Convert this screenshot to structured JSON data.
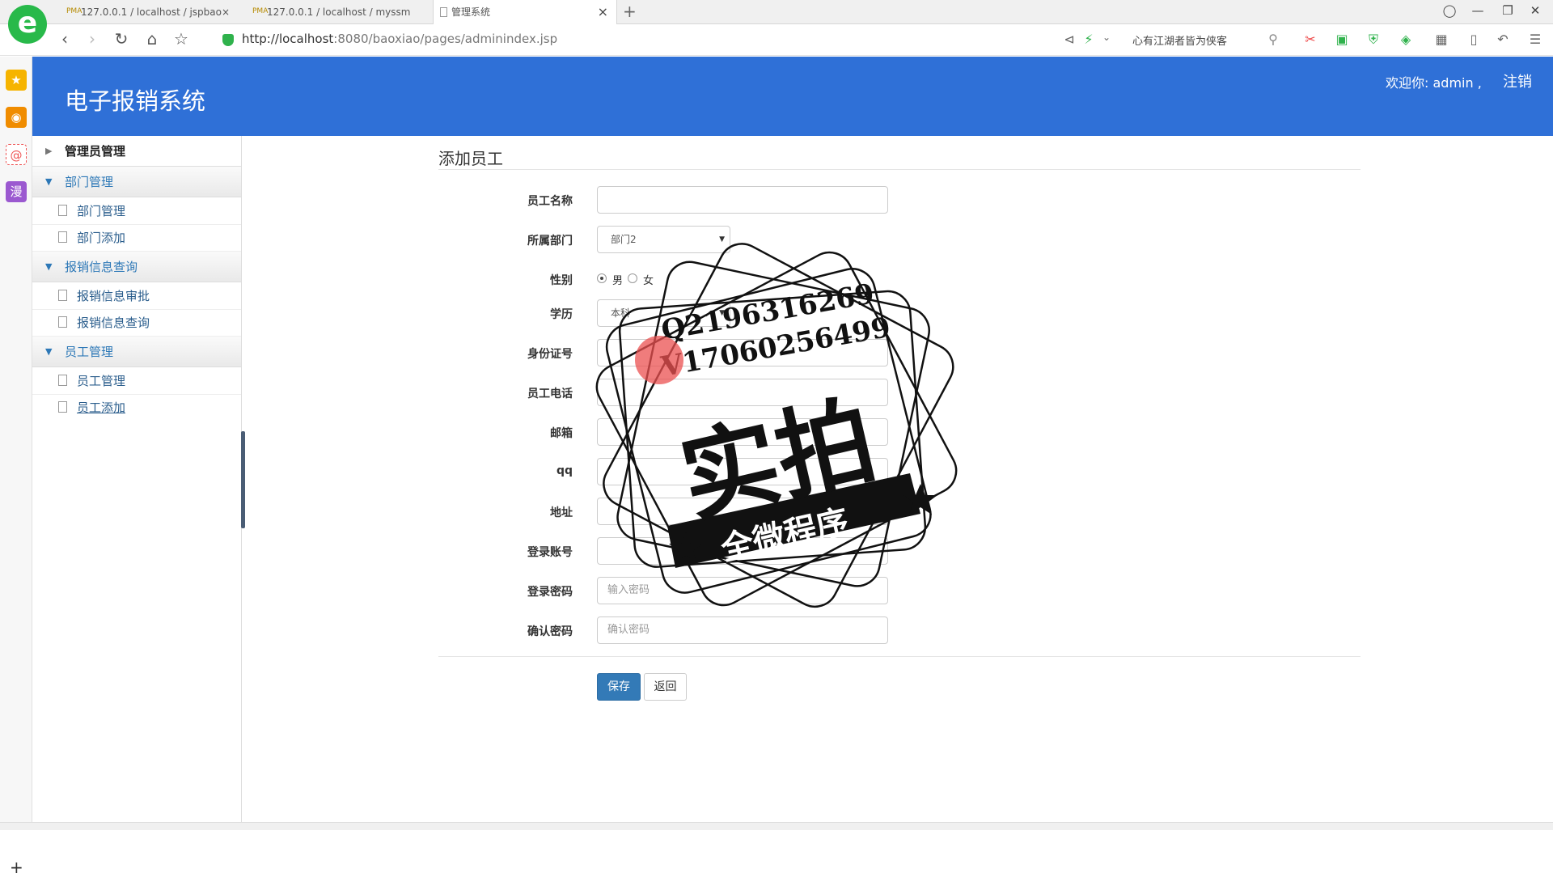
{
  "browser": {
    "tabs": [
      {
        "title": "127.0.0.1 / localhost / jspbao×",
        "icon_label": "PMA"
      },
      {
        "title": "127.0.0.1 / localhost / myssm",
        "icon_label": "PMA"
      },
      {
        "title": "管理系统",
        "close": "×"
      }
    ],
    "new_tab": "+",
    "url_host": "http://localhost",
    "url_rest": ":8080/baoxiao/pages/adminindex.jsp",
    "search_text": "心有江湖者皆为侠客"
  },
  "left_bar": {
    "icons": [
      "star-icon",
      "weibo-icon",
      "mail-icon",
      "comic-icon"
    ],
    "mail_glyph": "@",
    "comic_glyph": "漫",
    "add": "+"
  },
  "header": {
    "title": "电子报销系统",
    "welcome": "欢迎你: admin ,",
    "logout": "注销"
  },
  "sidebar": {
    "sections": [
      {
        "label": "管理员管理",
        "expanded": false,
        "items": []
      },
      {
        "label": "部门管理",
        "expanded": true,
        "items": [
          "部门管理",
          "部门添加"
        ]
      },
      {
        "label": "报销信息查询",
        "expanded": true,
        "items": [
          "报销信息审批",
          "报销信息查询"
        ]
      },
      {
        "label": "员工管理",
        "expanded": true,
        "items": [
          "员工管理",
          "员工添加"
        ]
      }
    ]
  },
  "form": {
    "title": "添加员工",
    "fields": {
      "name": {
        "label": "员工名称",
        "value": ""
      },
      "department": {
        "label": "所属部门",
        "value": "部门2"
      },
      "gender": {
        "label": "性别",
        "options": [
          "男",
          "女"
        ],
        "selected": "男"
      },
      "education": {
        "label": "学历",
        "value": "本科"
      },
      "id_number": {
        "label": "身份证号",
        "value": ""
      },
      "phone": {
        "label": "员工电话",
        "value": ""
      },
      "email": {
        "label": "邮箱",
        "value": ""
      },
      "qq": {
        "label": "qq",
        "value": ""
      },
      "address": {
        "label": "地址",
        "value": ""
      },
      "login_account": {
        "label": "登录账号",
        "value": ""
      },
      "login_password": {
        "label": "登录密码",
        "placeholder": "输入密码"
      },
      "confirm_password": {
        "label": "确认密码",
        "placeholder": "确认密码"
      }
    },
    "save": "保存",
    "back": "返回"
  },
  "watermark": {
    "line1": "Q2196316269",
    "line2": "V17060256499",
    "main": "实拍",
    "banner": "全微程序"
  },
  "colors": {
    "header_bg": "#2f70d7",
    "primary_button": "#337ab7",
    "sidebar_link": "#2d78b7"
  }
}
